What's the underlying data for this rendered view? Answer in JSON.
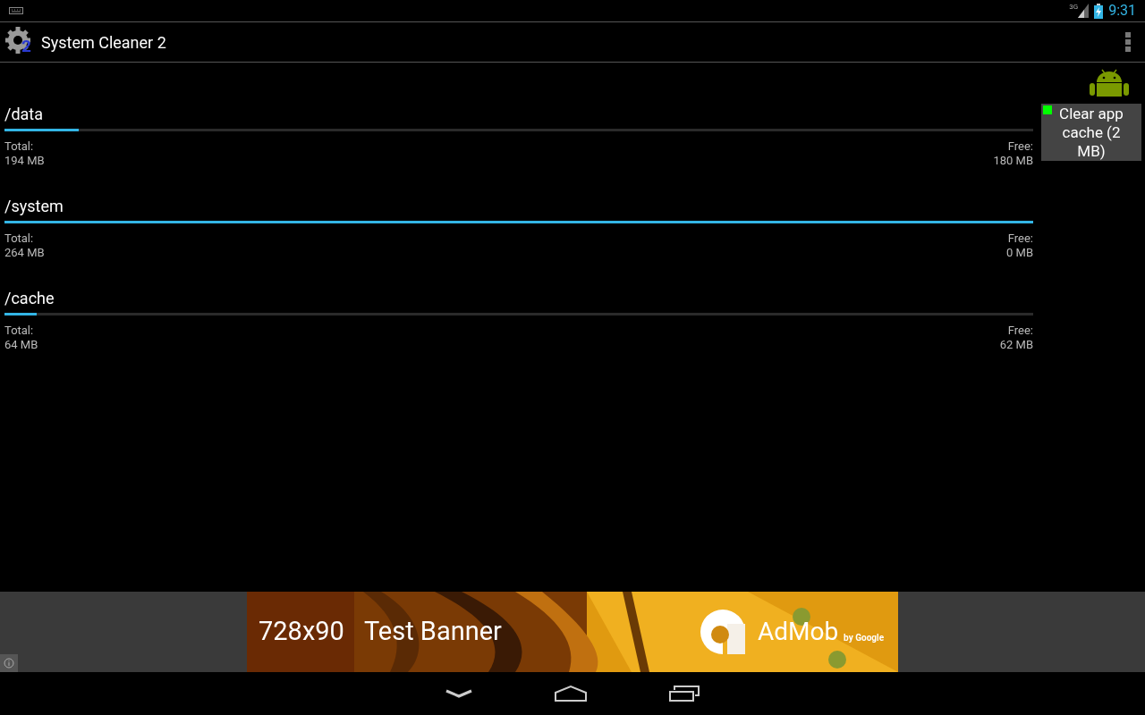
{
  "status_bar": {
    "network": "3G",
    "time": "9:31"
  },
  "action_bar": {
    "logo_badge": "2",
    "title": "System Cleaner 2"
  },
  "partitions": [
    {
      "name": "/data",
      "level": 0.072,
      "total_label": "Total:",
      "total": "194 MB",
      "free_label": "Free:",
      "free": "180 MB"
    },
    {
      "name": "/system",
      "level": 1.0,
      "total_label": "Total:",
      "total": "264 MB",
      "free_label": "Free:",
      "free": "0 MB"
    },
    {
      "name": "/cache",
      "level": 0.031,
      "total_label": "Total:",
      "total": "64 MB",
      "free_label": "Free:",
      "free": "62 MB"
    }
  ],
  "clear_button": {
    "label": "Clear app cache (2 MB)",
    "color": "#00ff00"
  },
  "ad_banner": {
    "size": "728x90",
    "title": "Test Banner",
    "brand": "AdMob",
    "byline": "by Google"
  }
}
